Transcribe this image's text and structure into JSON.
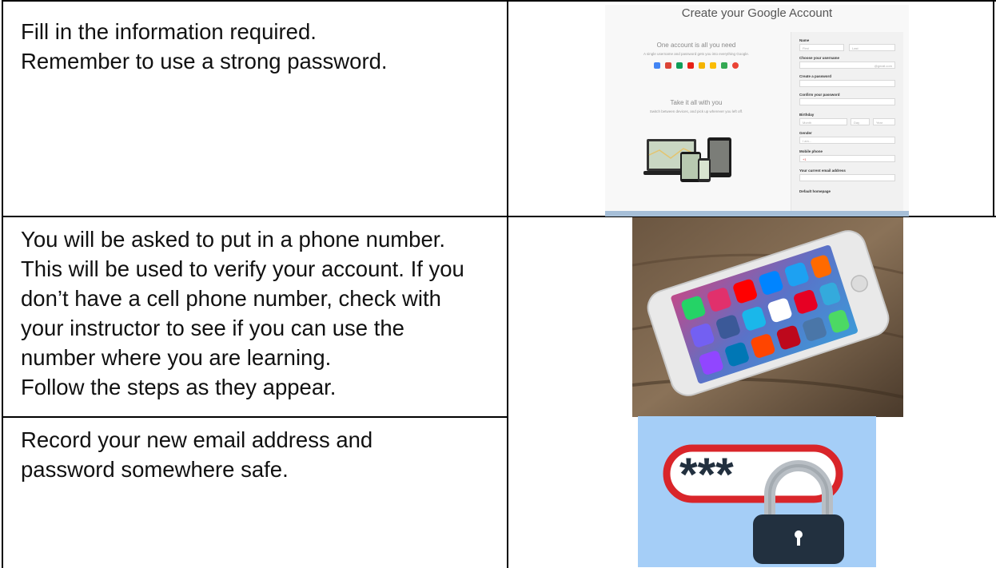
{
  "rows": [
    {
      "text_lines": [
        "Fill in the information required.",
        "Remember to use a strong password."
      ],
      "image": {
        "title": "Create your Google Account",
        "left_heading": "One account is all you need",
        "left_sub": "A single username and password gets you into everything Google.",
        "left_heading2": "Take it all with you",
        "left_sub2": "Switch between devices, and pick up wherever you left off.",
        "form": {
          "name_label": "Name",
          "first_placeholder": "First",
          "last_placeholder": "Last",
          "username_label": "Choose your username",
          "username_suffix": "@gmail.com",
          "password_label": "Create a password",
          "confirm_label": "Confirm your password",
          "birthday_label": "Birthday",
          "month_placeholder": "Month",
          "day_placeholder": "Day",
          "year_placeholder": "Year",
          "gender_label": "Gender",
          "gender_placeholder": "I am...",
          "phone_label": "Mobile phone",
          "phone_prefix": "+1",
          "email_label": "Your current email address",
          "homepage_label": "Default homepage"
        }
      }
    },
    {
      "text_lines": [
        "You will be asked to put in a phone number.",
        "This will be used to verify your account. If you",
        "don’t have a cell phone number, check with",
        "your instructor to see if you can use the",
        "number where you are learning.",
        "Follow the steps as they appear."
      ]
    },
    {
      "text_lines": [
        "Record your new email address and",
        "password somewhere safe."
      ],
      "image": {
        "masked_text": "***"
      }
    }
  ],
  "colors": {
    "lock_bg": "#a5cef7",
    "lock_red": "#d9252a",
    "lock_body": "#22303f"
  }
}
